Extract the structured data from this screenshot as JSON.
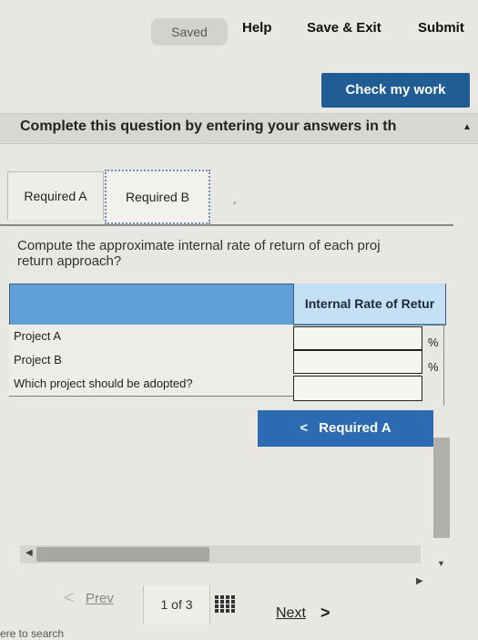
{
  "toolbar": {
    "saved": "Saved",
    "help": "Help",
    "save_exit": "Save & Exit",
    "submit": "Submit",
    "check_work": "Check my work"
  },
  "banner": {
    "text": "Complete this question by entering your answers in th"
  },
  "tabs": [
    {
      "label": "Required A"
    },
    {
      "label": "Required B"
    }
  ],
  "question": {
    "line1": "Compute the approximate internal rate of return of each proj",
    "line2": "return approach?"
  },
  "table": {
    "header": "Internal Rate of Retur",
    "rows": [
      {
        "label": "Project A",
        "unit": "%"
      },
      {
        "label": "Project B",
        "unit": "%"
      },
      {
        "label": "Which project should be adopted?",
        "unit": ""
      }
    ]
  },
  "nav_button": {
    "label": "Required A",
    "chevron": "<"
  },
  "pager": {
    "prev": "Prev",
    "page": "1 of 3",
    "next": "Next",
    "prev_chevron": "<",
    "next_chevron": ">"
  },
  "taskbar": {
    "search_hint": "ere to search"
  },
  "colors": {
    "primary_button": "#1f5d94",
    "table_header": "#5f9fd8"
  }
}
